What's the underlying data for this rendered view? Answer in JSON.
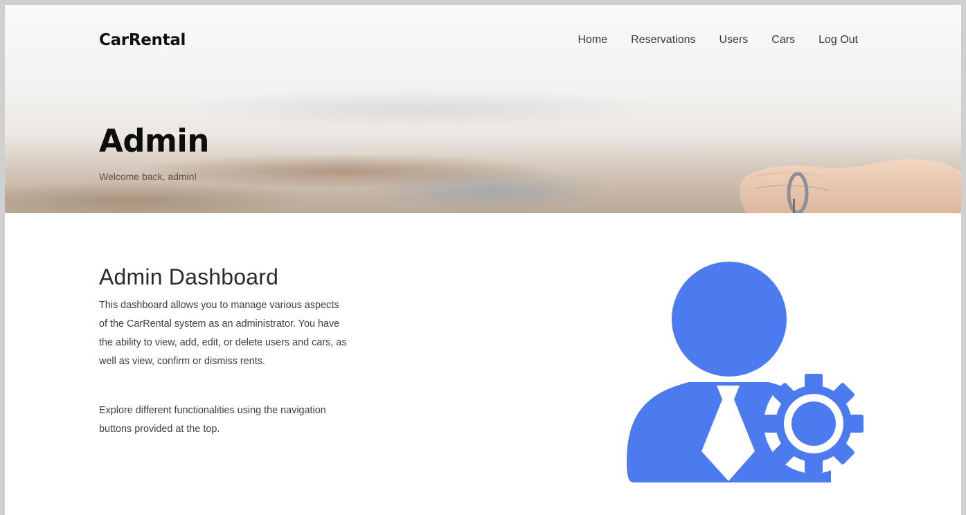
{
  "brand": "CarRental",
  "nav": {
    "home": "Home",
    "reservations": "Reservations",
    "users": "Users",
    "cars": "Cars",
    "logout": "Log Out"
  },
  "hero": {
    "title": "Admin",
    "subtitle": "Welcome back, admin!"
  },
  "dashboard": {
    "title": "Admin Dashboard",
    "paragraph1": "This dashboard allows you to manage various aspects of the CarRental system as an administrator. You have the ability to view, add, edit, or delete users and cars, as well as view, confirm or dismiss rents.",
    "paragraph2": "Explore different functionalities using the navigation buttons provided at the top."
  },
  "colors": {
    "icon_blue": "#4b7bef",
    "text_dark": "#111111"
  },
  "icons": {
    "admin": "admin-user-gear-icon"
  }
}
